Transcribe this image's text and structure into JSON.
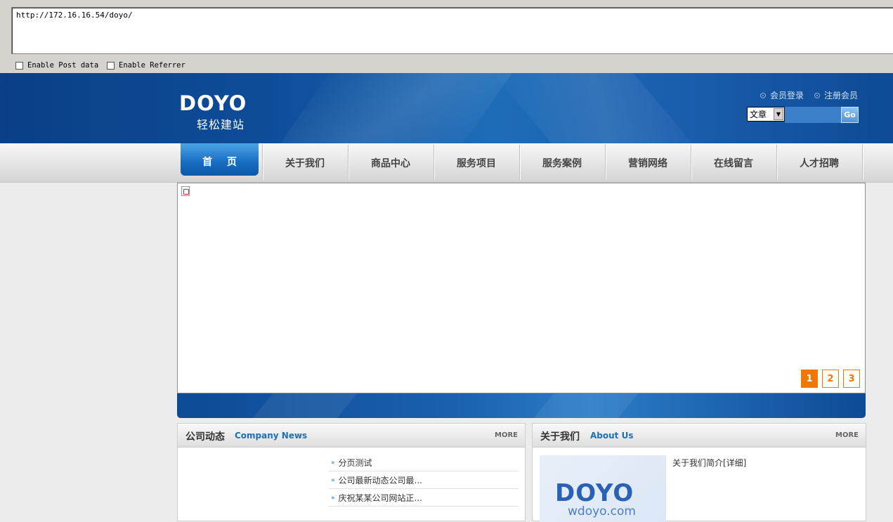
{
  "toolbar": {
    "url": "http://172.16.16.54/doyo/",
    "enable_post_label": "Enable Post data",
    "enable_referrer_label": "Enable Referrer"
  },
  "header": {
    "logo": "DOYO",
    "logo_sub": "轻松建站",
    "login_link": "会员登录",
    "register_link": "注册会员",
    "search_select": "文章",
    "search_go": "Go"
  },
  "nav": {
    "items": [
      "首 页",
      "关于我们",
      "商品中心",
      "服务项目",
      "服务案例",
      "营销网络",
      "在线留言",
      "人才招聘"
    ]
  },
  "banner": {
    "pages": [
      "1",
      "2",
      "3"
    ],
    "active_page": "1"
  },
  "news_panel": {
    "title": "公司动态",
    "subtitle": "Company News",
    "more": "MORE",
    "items": [
      "分页测试",
      "公司最新动态公司最...",
      "庆祝某某公司网站正..."
    ]
  },
  "about_panel": {
    "title": "关于我们",
    "subtitle": "About Us",
    "more": "MORE",
    "image_logo": "DOYO",
    "image_url": "wdoyo.com",
    "intro_link": "关于我们简介[详细]"
  },
  "colors": {
    "header_blue": "#0e4c98",
    "accent_orange": "#f07800",
    "link_blue": "#1d6fb8"
  }
}
